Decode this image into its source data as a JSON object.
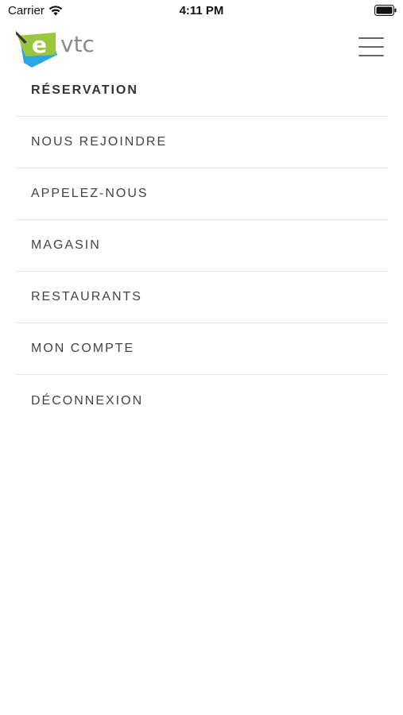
{
  "status_bar": {
    "carrier": "Carrier",
    "time": "4:11 PM",
    "wifi_icon": "wifi-icon",
    "battery_icon": "battery-icon"
  },
  "header": {
    "logo_text_e": "e",
    "logo_text_vtc": "vtc",
    "menu_icon": "hamburger-menu-icon"
  },
  "menu": {
    "items": [
      {
        "label": "RÉSERVATION",
        "active": true
      },
      {
        "label": "NOUS REJOINDRE",
        "active": false
      },
      {
        "label": "APPELEZ-NOUS",
        "active": false
      },
      {
        "label": "MAGASIN",
        "active": false
      },
      {
        "label": "RESTAURANTS",
        "active": false
      },
      {
        "label": "MON COMPTE",
        "active": false
      },
      {
        "label": "DÉCONNEXION",
        "active": false
      }
    ]
  },
  "colors": {
    "logo_green": "#9bc53d",
    "logo_blue": "#2aa7e0",
    "logo_gray": "#8a8a8a",
    "text": "#444444",
    "divider": "#e6e6e6"
  }
}
